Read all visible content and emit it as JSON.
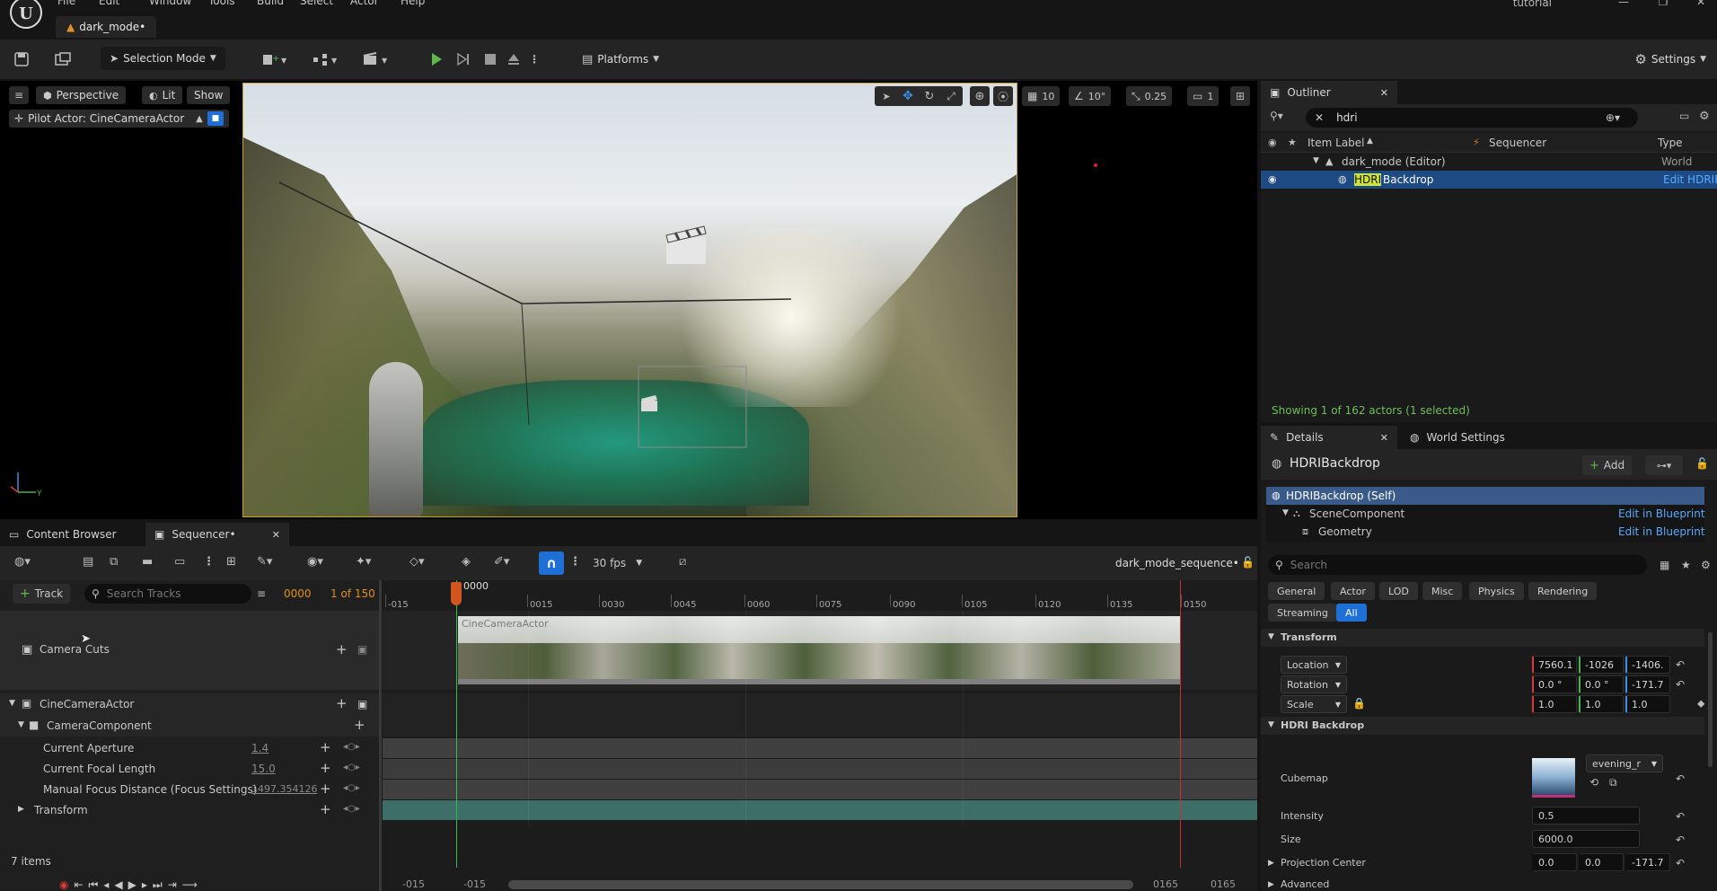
{
  "menu": [
    "File",
    "Edit",
    "Window",
    "Tools",
    "Build",
    "Select",
    "Actor",
    "Help"
  ],
  "project_name": "tutorial",
  "level_tab": "dark_mode•",
  "toolbar": {
    "selection_mode": "Selection Mode",
    "platforms": "Platforms",
    "settings": "Settings"
  },
  "viewport": {
    "perspective": "Perspective",
    "lit": "Lit",
    "show": "Show",
    "pilot_actor": "Pilot Actor: CineCameraActor",
    "grid_snap": "10",
    "rot_snap": "10°",
    "scale_snap": "0.25",
    "cam_speed": "1"
  },
  "outliner": {
    "tab": "Outliner",
    "search": "hdri",
    "col_label": "Item Label",
    "col_sequencer": "Sequencer",
    "col_type": "Type",
    "rows": [
      {
        "label": "dark_mode (Editor)",
        "type": "World"
      },
      {
        "label_hl": "HDRI",
        "label_rest": "Backdrop",
        "type": "Edit HDRIB"
      }
    ],
    "status": "Showing 1 of 162 actors (1 selected)"
  },
  "details": {
    "tab": "Details",
    "world_tab": "World Settings",
    "actor_name": "HDRIBackdrop",
    "add_label": "Add",
    "components": [
      {
        "name": "HDRIBackdrop (Self)",
        "link": ""
      },
      {
        "name": "SceneComponent",
        "link": "Edit in Blueprint"
      },
      {
        "name": "Geometry",
        "link": "Edit in Blueprint"
      }
    ],
    "search_placeholder": "Search",
    "filters": [
      "General",
      "Actor",
      "LOD",
      "Misc",
      "Physics",
      "Rendering",
      "Streaming",
      "All"
    ],
    "transform_header": "Transform",
    "location_label": "Location",
    "location": [
      "7560.1",
      "-1026",
      "-1406."
    ],
    "rotation_label": "Rotation",
    "rotation": [
      "0.0 °",
      "0.0 °",
      "-171.7"
    ],
    "scale_label": "Scale",
    "scale": [
      "1.0",
      "1.0",
      "1.0"
    ],
    "hdri_header": "HDRI Backdrop",
    "cubemap_label": "Cubemap",
    "cubemap_value": "evening_r",
    "intensity_label": "Intensity",
    "intensity": "0.5",
    "size_label": "Size",
    "size": "6000.0",
    "projection_label": "Projection Center",
    "projection": [
      "0.0",
      "0.0",
      "-171.7"
    ],
    "advanced_label": "Advanced"
  },
  "bottom_tabs": {
    "content_browser": "Content Browser",
    "sequencer": "Sequencer•"
  },
  "sequencer": {
    "fps": "30 fps",
    "sequence_name": "dark_mode_sequence•",
    "track_button": "Track",
    "search_placeholder": "Search Tracks",
    "current_frame": "0000",
    "frame_count": "1 of 150",
    "playhead": "0000",
    "ticks": [
      "-015",
      "0015",
      "0030",
      "0045",
      "0060",
      "0075",
      "0090",
      "0105",
      "0120",
      "0135",
      "0150"
    ],
    "tracks": {
      "camera_cuts": "Camera Cuts",
      "actor": "CineCameraActor",
      "component": "CameraComponent",
      "aperture_label": "Current Aperture",
      "aperture": "1.4",
      "focal_label": "Current Focal Length",
      "focal": "15.0",
      "focus_label": "Manual Focus Distance (Focus Settings)",
      "focus": "1497.354126",
      "transform_label": "Transform"
    },
    "clip_label": "CineCameraActor",
    "items_count": "7 items",
    "range_left_a": "-015",
    "range_left_b": "-015",
    "range_right_a": "0165",
    "range_right_b": "0165"
  }
}
